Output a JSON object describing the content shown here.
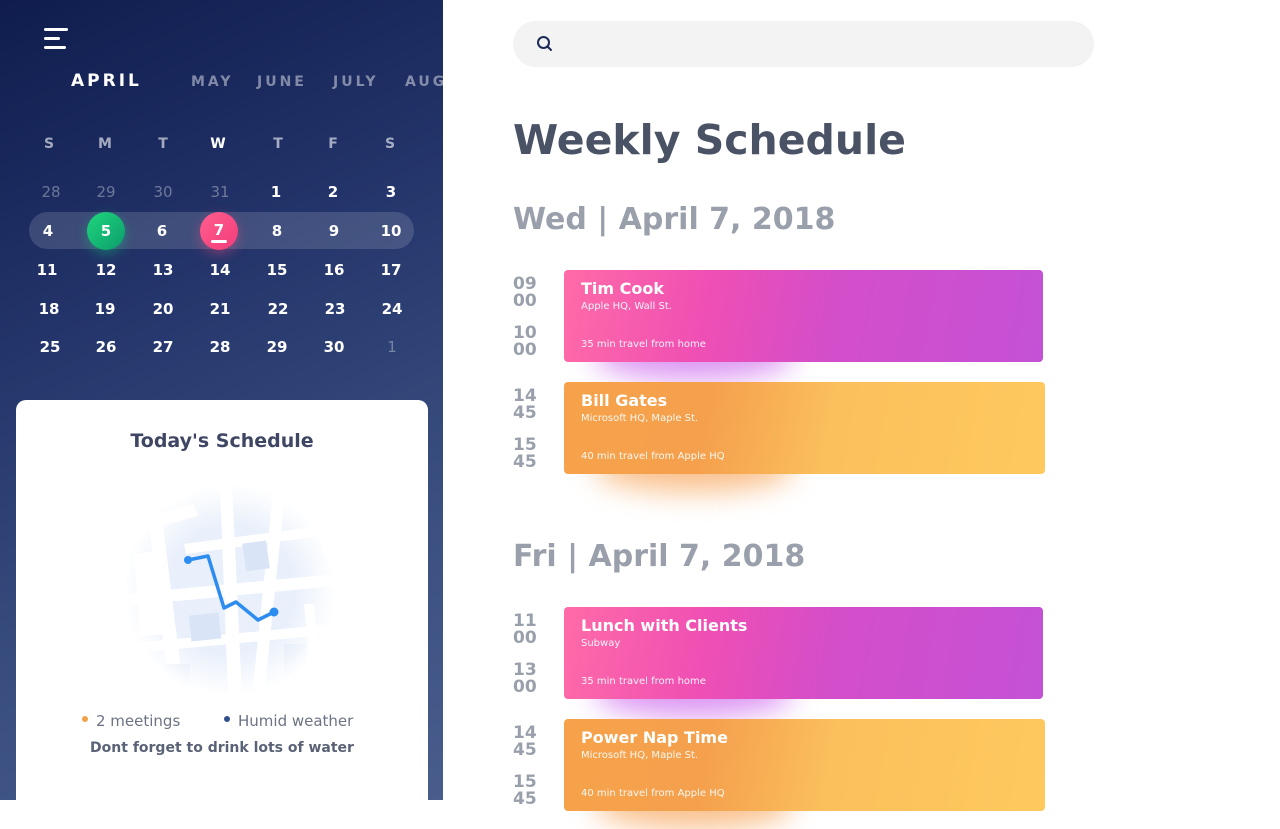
{
  "sidebar": {
    "months": [
      "APRIL",
      "MAY",
      "JUNE",
      "JULY",
      "AUG"
    ],
    "weekdays": [
      "S",
      "M",
      "T",
      "W",
      "T",
      "F",
      "S"
    ],
    "weeks": [
      [
        "28",
        "29",
        "30",
        "31",
        "1",
        "2",
        "3"
      ],
      [
        "4",
        "5",
        "6",
        "7",
        "8",
        "9",
        "10"
      ],
      [
        "11",
        "12",
        "13",
        "14",
        "15",
        "16",
        "17"
      ],
      [
        "18",
        "19",
        "20",
        "21",
        "22",
        "23",
        "24"
      ],
      [
        "25",
        "26",
        "27",
        "28",
        "29",
        "30",
        "1"
      ]
    ]
  },
  "today": {
    "title": "Today's Schedule",
    "meetings": "2 meetings",
    "weather": "Humid weather",
    "reminder": "Dont forget to drink lots of water"
  },
  "colors": {
    "meetings_dot": "#f0a24a",
    "weather_dot": "#2f4f8a",
    "route": "#2d8cf0"
  },
  "search": {
    "placeholder": ""
  },
  "main": {
    "title": "Weekly Schedule",
    "days": [
      {
        "heading": "Wed | April 7, 2018",
        "events": [
          {
            "start_h": "09",
            "start_m": "00",
            "end_h": "10",
            "end_m": "00",
            "name": "Tim Cook",
            "place": "Apple HQ, Wall St.",
            "travel": "35 min travel from home",
            "color": "pink"
          },
          {
            "start_h": "14",
            "start_m": "45",
            "end_h": "15",
            "end_m": "45",
            "name": "Bill Gates",
            "place": "Microsoft HQ, Maple St.",
            "travel": "40 min travel from Apple HQ",
            "color": "orange"
          }
        ]
      },
      {
        "heading": "Fri | April 7, 2018",
        "events": [
          {
            "start_h": "11",
            "start_m": "00",
            "end_h": "13",
            "end_m": "00",
            "name": "Lunch with Clients",
            "place": "Subway",
            "travel": "35 min travel from home",
            "color": "pink"
          },
          {
            "start_h": "14",
            "start_m": "45",
            "end_h": "15",
            "end_m": "45",
            "name": "Power Nap Time",
            "place": "Microsoft HQ, Maple St.",
            "travel": "40 min travel from Apple HQ",
            "color": "orange"
          }
        ]
      }
    ]
  }
}
